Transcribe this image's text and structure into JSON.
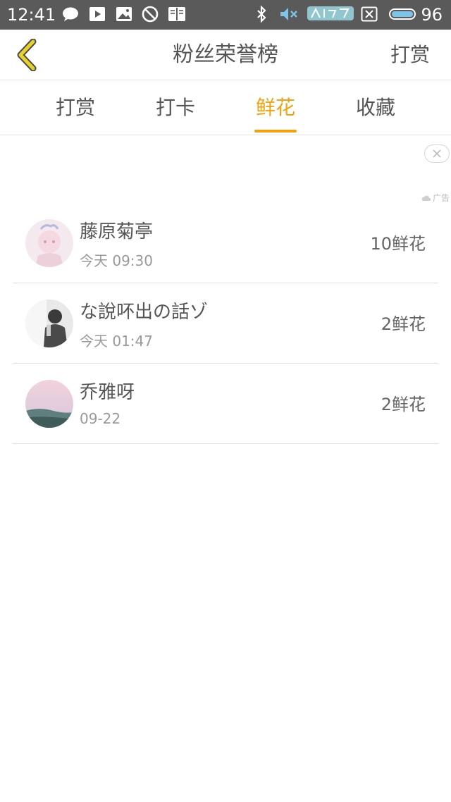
{
  "status_bar": {
    "time": "12:41",
    "battery": "96",
    "icons": [
      "chat-icon",
      "play-icon",
      "image-icon",
      "block-icon",
      "book-icon",
      "bluetooth-icon",
      "mute-icon",
      "app-logo-icon",
      "sim-icon",
      "battery-icon"
    ]
  },
  "header": {
    "title": "粉丝荣誉榜",
    "action_label": "打赏",
    "back_icon": "back-chevron-icon"
  },
  "tabs": [
    {
      "label": "打赏",
      "active": false
    },
    {
      "label": "打卡",
      "active": false
    },
    {
      "label": "鲜花",
      "active": true
    },
    {
      "label": "收藏",
      "active": false
    }
  ],
  "ad": {
    "tag_label": "广告",
    "close_icon": "close-icon"
  },
  "fans": [
    {
      "name": "藤原菊亭",
      "time": "今天 09:30",
      "count": "10鲜花"
    },
    {
      "name": "な說吥出の話ゾ",
      "time": "今天 01:47",
      "count": "2鲜花"
    },
    {
      "name": "乔雅呀",
      "time": "09-22",
      "count": "2鲜花"
    }
  ],
  "colors": {
    "accent": "#f2a20c",
    "status_bar": "#5a5a5a",
    "back_icon": "#e8d22a"
  }
}
